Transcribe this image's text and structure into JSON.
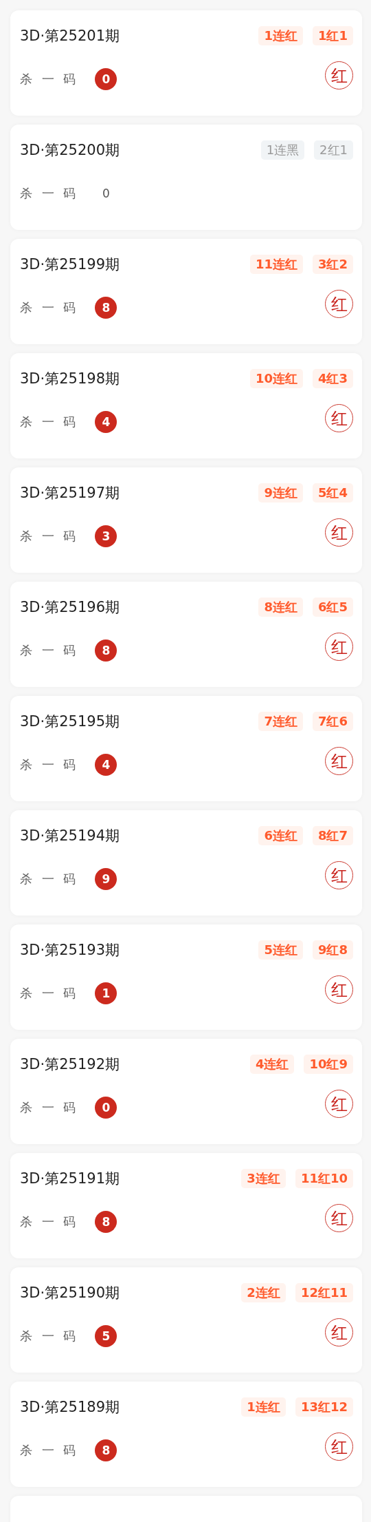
{
  "cards": [
    {
      "title": "3D·第25201期",
      "tags": [
        {
          "text": "1连红",
          "kind": "red"
        },
        {
          "text": "1红1",
          "kind": "red"
        }
      ],
      "kill_label": "杀 一 码",
      "kill_number": "0",
      "hit": true,
      "stamp": "红"
    },
    {
      "title": "3D·第25200期",
      "tags": [
        {
          "text": "1连黑",
          "kind": "black"
        },
        {
          "text": "2红1",
          "kind": "black"
        }
      ],
      "kill_label": "杀 一 码",
      "kill_number": "0",
      "hit": false
    },
    {
      "title": "3D·第25199期",
      "tags": [
        {
          "text": "11连红",
          "kind": "red"
        },
        {
          "text": "3红2",
          "kind": "red"
        }
      ],
      "kill_label": "杀 一 码",
      "kill_number": "8",
      "hit": true,
      "stamp": "红"
    },
    {
      "title": "3D·第25198期",
      "tags": [
        {
          "text": "10连红",
          "kind": "red"
        },
        {
          "text": "4红3",
          "kind": "red"
        }
      ],
      "kill_label": "杀 一 码",
      "kill_number": "4",
      "hit": true,
      "stamp": "红"
    },
    {
      "title": "3D·第25197期",
      "tags": [
        {
          "text": "9连红",
          "kind": "red"
        },
        {
          "text": "5红4",
          "kind": "red"
        }
      ],
      "kill_label": "杀 一 码",
      "kill_number": "3",
      "hit": true,
      "stamp": "红"
    },
    {
      "title": "3D·第25196期",
      "tags": [
        {
          "text": "8连红",
          "kind": "red"
        },
        {
          "text": "6红5",
          "kind": "red"
        }
      ],
      "kill_label": "杀 一 码",
      "kill_number": "8",
      "hit": true,
      "stamp": "红"
    },
    {
      "title": "3D·第25195期",
      "tags": [
        {
          "text": "7连红",
          "kind": "red"
        },
        {
          "text": "7红6",
          "kind": "red"
        }
      ],
      "kill_label": "杀 一 码",
      "kill_number": "4",
      "hit": true,
      "stamp": "红"
    },
    {
      "title": "3D·第25194期",
      "tags": [
        {
          "text": "6连红",
          "kind": "red"
        },
        {
          "text": "8红7",
          "kind": "red"
        }
      ],
      "kill_label": "杀 一 码",
      "kill_number": "9",
      "hit": true,
      "stamp": "红"
    },
    {
      "title": "3D·第25193期",
      "tags": [
        {
          "text": "5连红",
          "kind": "red"
        },
        {
          "text": "9红8",
          "kind": "red"
        }
      ],
      "kill_label": "杀 一 码",
      "kill_number": "1",
      "hit": true,
      "stamp": "红"
    },
    {
      "title": "3D·第25192期",
      "tags": [
        {
          "text": "4连红",
          "kind": "red"
        },
        {
          "text": "10红9",
          "kind": "red"
        }
      ],
      "kill_label": "杀 一 码",
      "kill_number": "0",
      "hit": true,
      "stamp": "红"
    },
    {
      "title": "3D·第25191期",
      "tags": [
        {
          "text": "3连红",
          "kind": "red"
        },
        {
          "text": "11红10",
          "kind": "red"
        }
      ],
      "kill_label": "杀 一 码",
      "kill_number": "8",
      "hit": true,
      "stamp": "红"
    },
    {
      "title": "3D·第25190期",
      "tags": [
        {
          "text": "2连红",
          "kind": "red"
        },
        {
          "text": "12红11",
          "kind": "red"
        }
      ],
      "kill_label": "杀 一 码",
      "kill_number": "5",
      "hit": true,
      "stamp": "红"
    },
    {
      "title": "3D·第25189期",
      "tags": [
        {
          "text": "1连红",
          "kind": "red"
        },
        {
          "text": "13红12",
          "kind": "red"
        }
      ],
      "kill_label": "杀 一 码",
      "kill_number": "8",
      "hit": true,
      "stamp": "红"
    }
  ]
}
